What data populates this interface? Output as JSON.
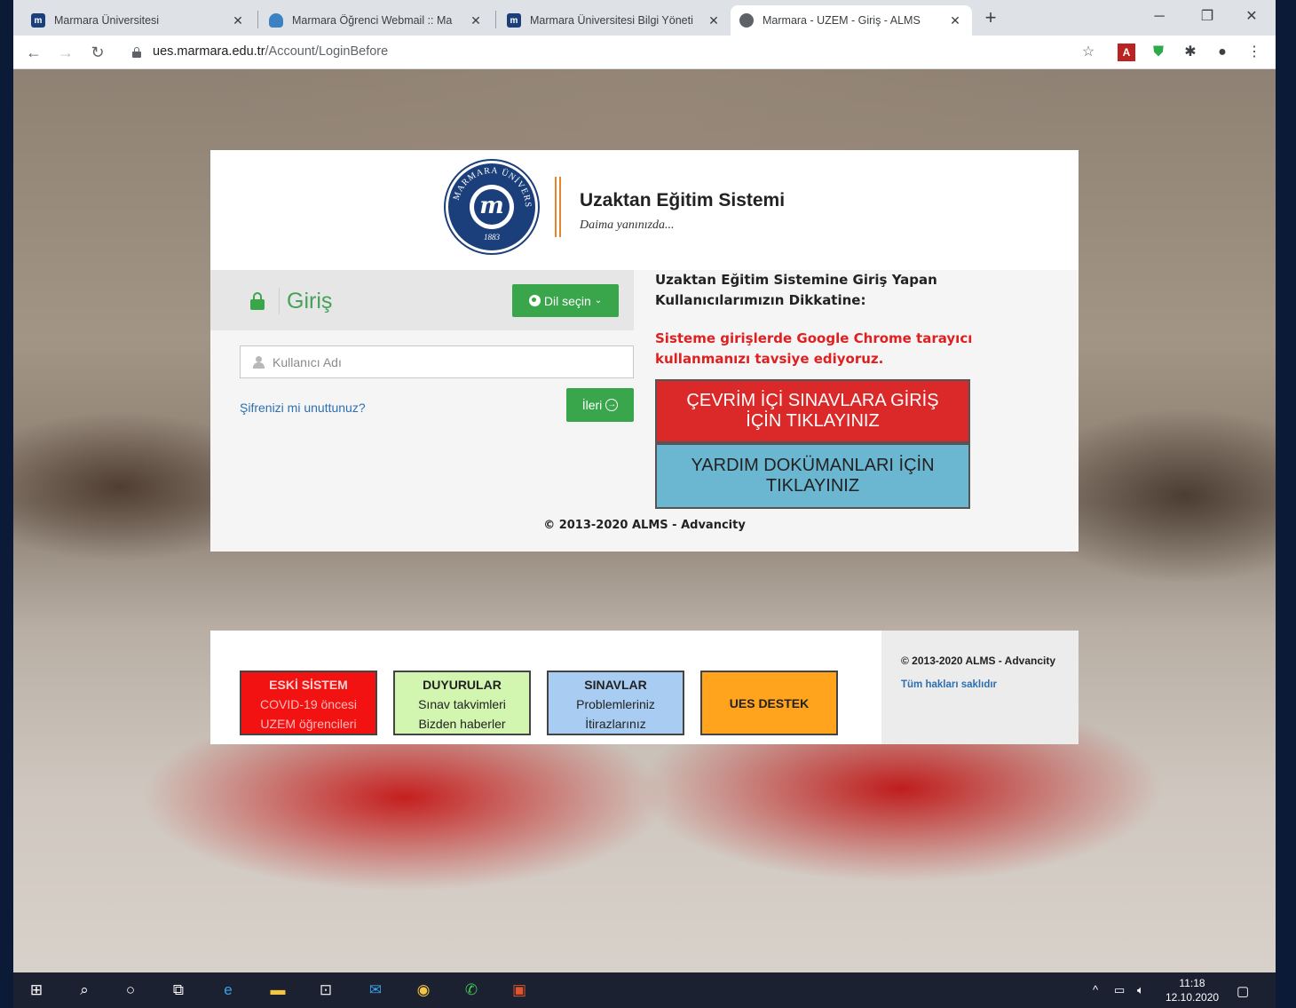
{
  "browser": {
    "tabs": [
      {
        "label": "Marmara Üniversitesi",
        "favicon_color": "#1b3f7a"
      },
      {
        "label": "Marmara Öğrenci Webmail :: Ma",
        "favicon_color": "#3b82c4"
      },
      {
        "label": "Marmara Üniversitesi Bilgi Yöneti",
        "favicon_color": "#1b3f7a"
      },
      {
        "label": "Marmara - UZEM - Giriş - ALMS",
        "favicon_color": "#5f6368"
      }
    ],
    "url_host": "ues.marmara.edu.tr",
    "url_path": "/Account/LoginBefore",
    "icons": [
      "star-icon",
      "pdf-extension-icon",
      "shield-extension-icon",
      "puzzle-icon",
      "profile-icon",
      "menu-icon"
    ]
  },
  "brand": {
    "title": "Uzaktan Eğitim Sistemi",
    "subtitle": "Daima yanınızda...",
    "seal_year": "1883",
    "seal_ring_text": "MARMARA ÜNİVERSİTESİ"
  },
  "login": {
    "title": "Giriş",
    "lang_button": "Dil seçin",
    "username_placeholder": "Kullanıcı Adı",
    "forgot_link": "Şifrenizi mi unuttunuz?",
    "next_button": "İleri"
  },
  "notice": {
    "title": "Uzaktan Eğitim Sistemine Giriş Yapan Kullanıcılarımızın Dikkatine:",
    "warning": "Sisteme girişlerde Google Chrome tarayıcı kullanmanızı tavsiye ediyoruz.",
    "exam_button_line1": "ÇEVRİM İÇİ SINAVLARA GİRİŞ",
    "exam_button_line2": "İÇİN TIKLAYINIZ",
    "help_button_line1": "YARDIM DOKÜMANLARI İÇİN",
    "help_button_line2": "TIKLAYINIZ"
  },
  "copyright": "© 2013-2020 ALMS - Advancity",
  "footer": {
    "boxes": [
      {
        "title": "ESKİ SİSTEM",
        "line1": "COVID-19 öncesi",
        "line2": "UZEM öğrencileri",
        "color": "#f21212"
      },
      {
        "title": "DUYURULAR",
        "line1": "Sınav takvimleri",
        "line2": "Bizden haberler",
        "color": "#d2f5b0"
      },
      {
        "title": "SINAVLAR",
        "line1": "Problemleriniz",
        "line2": "İtirazlarınız",
        "color": "#a9cdf2"
      },
      {
        "title": "UES DESTEK",
        "color": "#ffa41c"
      }
    ],
    "copyright": "© 2013-2020 ALMS - Advancity",
    "rights": "Tüm hakları saklıdır"
  },
  "taskbar": {
    "time": "11:18",
    "date": "12.10.2020"
  },
  "colors": {
    "accent_green": "#3aa64b",
    "exam_red": "#db2828",
    "help_blue": "#6bb7d1",
    "brand_orange": "#e8842c"
  }
}
